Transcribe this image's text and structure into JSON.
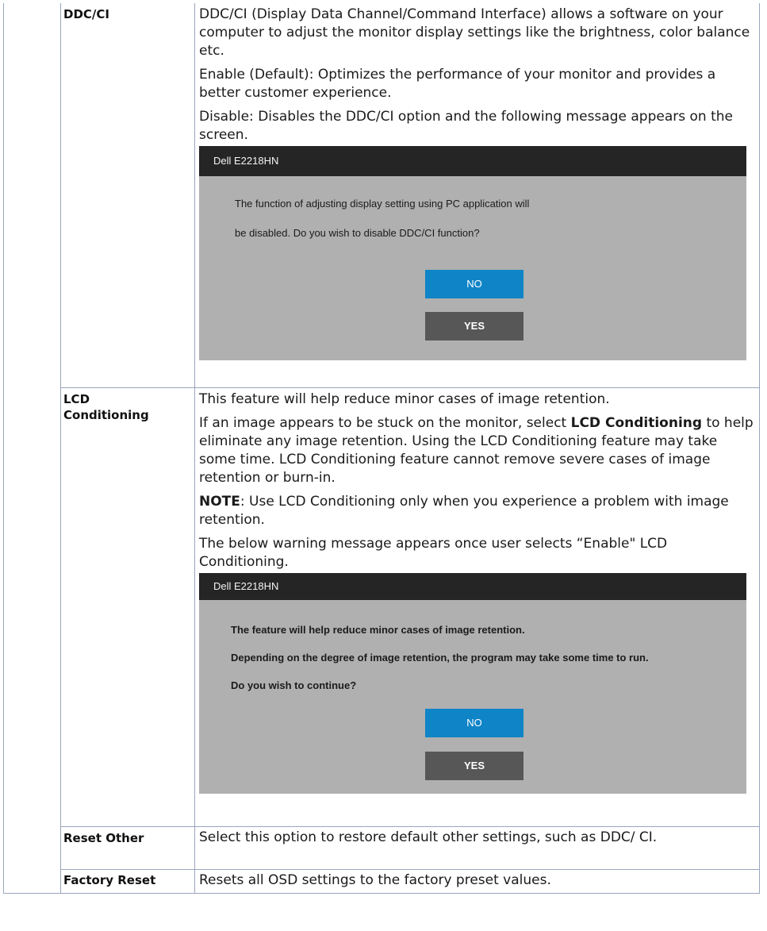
{
  "rows": [
    {
      "label": "DDC/CI",
      "paragraphs": [
        "DDC/CI (Display Data Channel/Command Interface) allows a software on your computer to adjust the monitor display settings like the brightness, color balance etc.",
        "Enable (Default): Optimizes the performance of your monitor and provides a better customer experience.",
        "Disable: Disables the DDC/CI option and the following message appears on the screen."
      ],
      "osd": {
        "title": "Dell  E2218HN",
        "lines": [
          "The function of adjusting display setting using PC application will",
          "be disabled. Do you wish to disable DDC/CI function?"
        ],
        "no_label": "NO",
        "yes_label": "YES"
      }
    },
    {
      "label": "LCD Conditioning",
      "p1": "This feature will help reduce minor cases of image retention.",
      "p2_before": "If an image appears to be stuck on the monitor, select ",
      "p2_bold": "LCD Conditioning",
      "p2_after": " to help eliminate any image retention. Using the LCD Conditioning feature may take some time. LCD Conditioning feature cannot remove  severe cases of image retention or burn-in.",
      "note_bold": "NOTE",
      "note_text": ": Use LCD Conditioning only when you experience a problem with image retention.",
      "p4": "The below warning message appears once user selects “Enable\" LCD Conditioning.",
      "osd": {
        "title": "Dell  E2218HN",
        "lines": [
          "The feature will help reduce minor cases of image retention.",
          "Depending on the degree of image retention, the program may take some time to run.",
          "Do you wish to continue?"
        ],
        "no_label": "NO",
        "yes_label": "YES"
      }
    },
    {
      "label": "Reset Other",
      "text": "Select this option to restore default other settings, such as DDC/ CI."
    },
    {
      "label": "Factory Reset",
      "text": "Resets all OSD settings to the factory preset values."
    }
  ]
}
